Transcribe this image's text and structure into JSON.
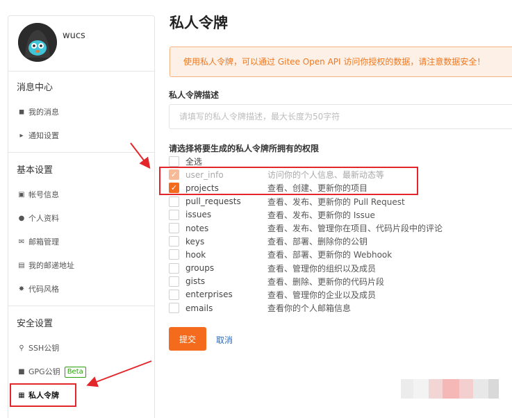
{
  "user": {
    "name": "wucs"
  },
  "sidebar": {
    "groups": [
      {
        "title": "消息中心",
        "items": [
          {
            "icon": "bell-icon",
            "label": "我的消息"
          },
          {
            "icon": "speaker-icon",
            "label": "通知设置"
          }
        ]
      },
      {
        "title": "基本设置",
        "items": [
          {
            "icon": "id-card-icon",
            "label": "帐号信息"
          },
          {
            "icon": "user-icon",
            "label": "个人资料"
          },
          {
            "icon": "envelope-icon",
            "label": "邮箱管理"
          },
          {
            "icon": "address-card-icon",
            "label": "我的邮递地址"
          },
          {
            "icon": "code-style-icon",
            "label": "代码风格"
          }
        ]
      },
      {
        "title": "安全设置",
        "items": [
          {
            "icon": "key-icon",
            "label": "SSH公钥"
          },
          {
            "icon": "lock-icon",
            "label": "GPG公钥",
            "badge": "Beta"
          },
          {
            "icon": "token-icon",
            "label": "私人令牌",
            "active": true
          }
        ]
      }
    ]
  },
  "main": {
    "title": "私人令牌",
    "alert": "使用私人令牌，可以通过 Gitee Open API 访问你授权的数据，请注意数据安全！",
    "desc_label": "私人令牌描述",
    "desc_placeholder": "请填写的私人令牌描述，最大长度为50字符",
    "perm_label": "请选择将要生成的私人令牌所拥有的权限",
    "select_all": "全选",
    "permissions": [
      {
        "name": "user_info",
        "desc": "访问你的个人信息、最新动态等",
        "checked": true,
        "disabled": true
      },
      {
        "name": "projects",
        "desc": "查看、创建、更新你的项目",
        "checked": true,
        "disabled": false
      },
      {
        "name": "pull_requests",
        "desc": "查看、发布、更新你的 Pull Request",
        "checked": false
      },
      {
        "name": "issues",
        "desc": "查看、发布、更新你的 Issue",
        "checked": false
      },
      {
        "name": "notes",
        "desc": "查看、发布、管理你在项目、代码片段中的评论",
        "checked": false
      },
      {
        "name": "keys",
        "desc": "查看、部署、删除你的公钥",
        "checked": false
      },
      {
        "name": "hook",
        "desc": "查看、部署、更新你的 Webhook",
        "checked": false
      },
      {
        "name": "groups",
        "desc": "查看、管理你的组织以及成员",
        "checked": false
      },
      {
        "name": "gists",
        "desc": "查看、删除、更新你的代码片段",
        "checked": false
      },
      {
        "name": "enterprises",
        "desc": "查看、管理你的企业以及成员",
        "checked": false
      },
      {
        "name": "emails",
        "desc": "查看你的个人邮箱信息",
        "checked": false
      }
    ],
    "submit_label": "提交",
    "cancel_label": "取消"
  },
  "colors": {
    "accent": "#f56b1e",
    "alert_text": "#f0771f",
    "highlight": "#e3262a",
    "link": "#2a6cc2"
  }
}
